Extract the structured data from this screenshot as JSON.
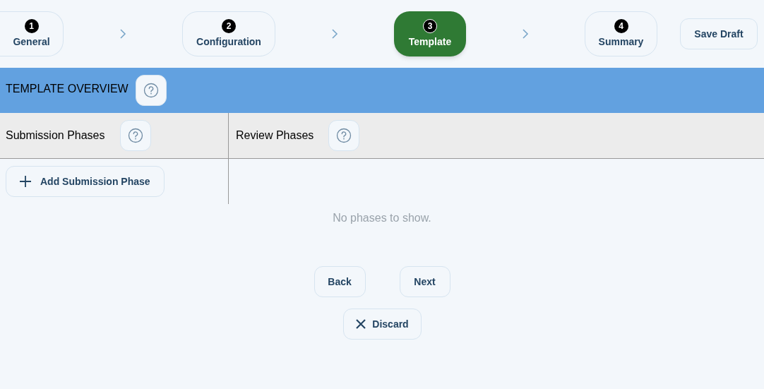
{
  "steps": [
    {
      "number": "1",
      "label": "General",
      "selected": false
    },
    {
      "number": "2",
      "label": "Configuration",
      "selected": false
    },
    {
      "number": "3",
      "label": "Template",
      "selected": true
    },
    {
      "number": "4",
      "label": "Summary",
      "selected": false
    }
  ],
  "save_button": "Save Draft",
  "section": {
    "title": "TEMPLATE OVERVIEW"
  },
  "columns": [
    {
      "title": "Submission Phases",
      "button": "Add Submission Phase"
    },
    {
      "title": "Review Phases"
    }
  ],
  "empty_message": "No phases to show.",
  "nav": {
    "back": "Back",
    "next": "Next",
    "discard": "Discard"
  }
}
